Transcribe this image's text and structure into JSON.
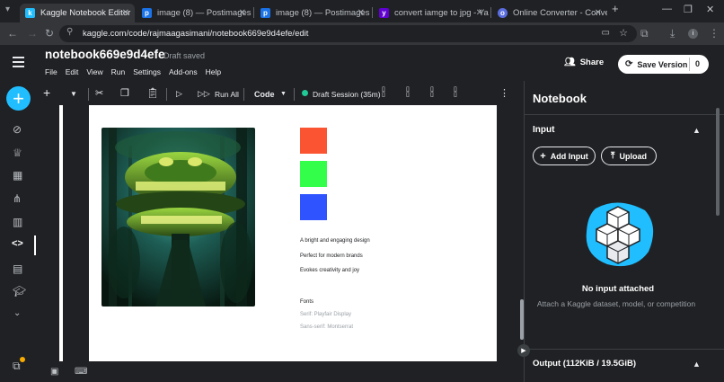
{
  "browser": {
    "tabs": [
      {
        "title": "Kaggle Notebook Editor",
        "fav": "k",
        "color": "#20beff"
      },
      {
        "title": "image (8) — Postimages",
        "fav": "p",
        "color": "#1a73e8"
      },
      {
        "title": "image (8) — Postimages",
        "fav": "p",
        "color": "#1a73e8"
      },
      {
        "title": "convert iamge to jpg - Yahoo",
        "fav": "y",
        "color": "#6001d2"
      },
      {
        "title": "Online Converter - Convert I",
        "fav": "o",
        "color": "#5b6ee1"
      }
    ],
    "url": "kaggle.com/code/rajmaagasimani/notebook669e9d4efe/edit"
  },
  "header": {
    "title": "notebook669e9d4efe",
    "status": "Draft saved",
    "menu": [
      "File",
      "Edit",
      "View",
      "Run",
      "Settings",
      "Add-ons",
      "Help"
    ],
    "share_label": "Share",
    "save_label": "Save Version",
    "save_count": "0"
  },
  "toolbar": {
    "run_all": "Run All",
    "cell_type": "Code",
    "session": "Draft Session (35m)"
  },
  "output": {
    "swatch_colors": [
      "#fb5432",
      "#33ff4a",
      "#2f54ff"
    ],
    "lines": [
      "A bright and engaging design",
      "Perfect for modern brands",
      "Evokes creativity and joy"
    ],
    "fonts_heading": "Fonts",
    "font_serif": "Serif: Playfair Display",
    "font_sans": "Sans-serif: Montserrat"
  },
  "panel": {
    "title": "Notebook",
    "input_section": "Input",
    "add_input": "Add Input",
    "upload": "Upload",
    "empty_title": "No input attached",
    "empty_desc": "Attach a Kaggle dataset, model, or competition",
    "output_section": "Output (112KiB / 19.5GiB)"
  }
}
